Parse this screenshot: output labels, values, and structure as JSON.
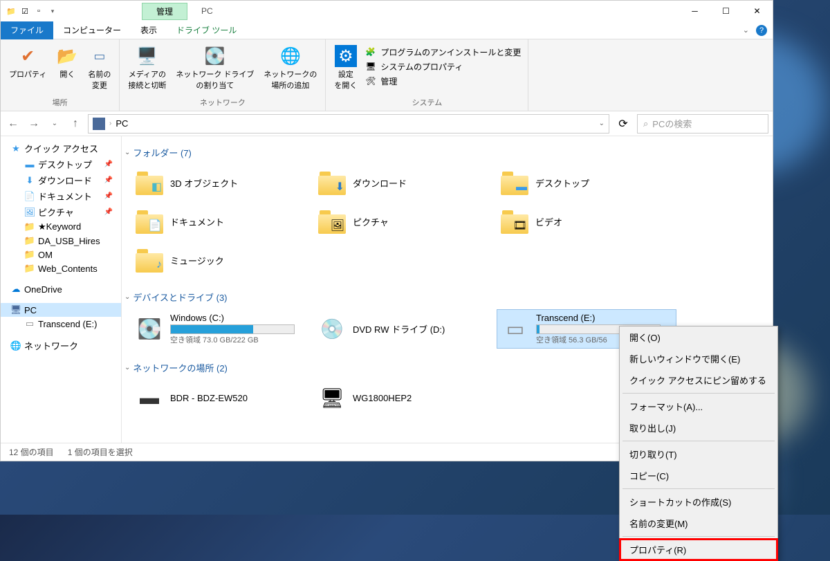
{
  "title_bar": {
    "manage_tab": "管理",
    "title": "PC"
  },
  "ribbon_tabs": {
    "file": "ファイル",
    "computer": "コンピューター",
    "view": "表示",
    "drive_tools": "ドライブ ツール"
  },
  "ribbon": {
    "location": {
      "properties": "プロパティ",
      "open": "開く",
      "rename": "名前の\n変更",
      "group_label": "場所"
    },
    "network": {
      "media": "メディアの\n接続と切断",
      "map_drive": "ネットワーク ドライブ\nの割り当て",
      "add_location": "ネットワークの\n場所の追加",
      "group_label": "ネットワーク"
    },
    "system": {
      "settings": "設定\nを開く",
      "uninstall": "プログラムのアンインストールと変更",
      "sys_props": "システムのプロパティ",
      "manage": "管理",
      "group_label": "システム"
    }
  },
  "address": {
    "location": "PC",
    "search_placeholder": "PCの検索"
  },
  "tree": {
    "quick_access": "クイック アクセス",
    "desktop": "デスクトップ",
    "downloads": "ダウンロード",
    "documents": "ドキュメント",
    "pictures": "ピクチャ",
    "keyword": "★Keyword",
    "da_usb": "DA_USB_Hires",
    "om": "OM",
    "web_contents": "Web_Contents",
    "onedrive": "OneDrive",
    "pc": "PC",
    "transcend": "Transcend (E:)",
    "network": "ネットワーク"
  },
  "groups": {
    "folders": {
      "label": "フォルダー (7)",
      "items": [
        {
          "name": "3D オブジェクト"
        },
        {
          "name": "ダウンロード"
        },
        {
          "name": "デスクトップ"
        },
        {
          "name": "ドキュメント"
        },
        {
          "name": "ピクチャ"
        },
        {
          "name": "ビデオ"
        },
        {
          "name": "ミュージック"
        }
      ]
    },
    "drives": {
      "label": "デバイスとドライブ (3)",
      "items": [
        {
          "name": "Windows (C:)",
          "sub": "空き領域 73.0 GB/222 GB",
          "fill": 67
        },
        {
          "name": "DVD RW ドライブ (D:)"
        },
        {
          "name": "Transcend (E:)",
          "sub": "空き領域 56.3 GB/56"
        }
      ]
    },
    "net_locations": {
      "label": "ネットワークの場所 (2)",
      "items": [
        {
          "name": "BDR - BDZ-EW520"
        },
        {
          "name": "WG1800HEP2"
        }
      ]
    }
  },
  "status": {
    "count": "12 個の項目",
    "selected": "1 個の項目を選択"
  },
  "context_menu": {
    "open": "開く(O)",
    "open_new": "新しいウィンドウで開く(E)",
    "pin_qa": "クイック アクセスにピン留めする",
    "format": "フォーマット(A)...",
    "eject": "取り出し(J)",
    "cut": "切り取り(T)",
    "copy": "コピー(C)",
    "shortcut": "ショートカットの作成(S)",
    "rename": "名前の変更(M)",
    "properties": "プロパティ(R)"
  }
}
